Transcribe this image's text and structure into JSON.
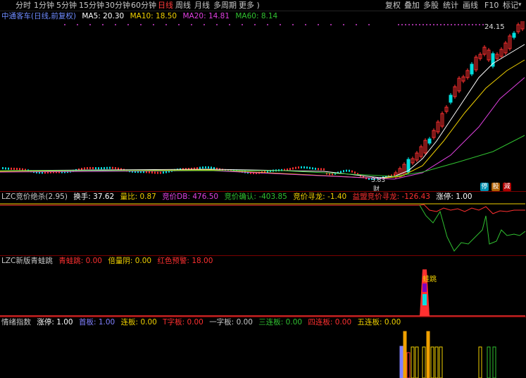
{
  "toolbar": {
    "periods": [
      "分时",
      "1分钟",
      "5分钟",
      "15分钟",
      "30分钟",
      "60分钟",
      "日线",
      "周线",
      "月线",
      "多周期",
      "更多 )"
    ],
    "active_period": "日线",
    "tools": [
      "复权",
      "叠加",
      "多股",
      "统计",
      "画线",
      "F10",
      "标记"
    ],
    "menu_icon": "chevron-down-icon"
  },
  "main_panel": {
    "stock_name": "中通客车",
    "mode": "(日线,前复权)",
    "ma": [
      {
        "label": "MA5: 20.30",
        "color": "#ffffff"
      },
      {
        "label": "MA10: 18.50",
        "color": "#f0d000"
      },
      {
        "label": "MA20: 14.81",
        "color": "#e040e0"
      },
      {
        "label": "MA60: 8.14",
        "color": "#30c030"
      }
    ],
    "high_label": "24.15",
    "low_label": "3.83",
    "cai_label": "财",
    "badges": [
      {
        "text": "停",
        "color": "#00a0c0"
      },
      {
        "text": "股",
        "color": "#c07000"
      },
      {
        "text": "減",
        "color": "#c00000"
      }
    ]
  },
  "panel2": {
    "items": [
      {
        "label": "LZC竞价绝杀(2.95)",
        "color": "#c8c8c8"
      },
      {
        "label": "换手: 37.62",
        "color": "#ffffff"
      },
      {
        "label": "量比: 0.87",
        "color": "#f0d000"
      },
      {
        "label": "竞价DB: 476.50",
        "color": "#e040e0"
      },
      {
        "label": "竞价确认: -403.85",
        "color": "#30c030"
      },
      {
        "label": "竞价寻龙: -1.40",
        "color": "#f0d000"
      },
      {
        "label": "益盟竞价寻龙: -126.43",
        "color": "#ff3030"
      },
      {
        "label": "涨停: 1.00",
        "color": "#ffffff"
      }
    ]
  },
  "panel3": {
    "items": [
      {
        "label": "LZC新版青蛙跳",
        "color": "#c8c8c8"
      },
      {
        "label": "青蛙跳: 0.00",
        "color": "#ff3030"
      },
      {
        "label": "倍量阴: 0.00",
        "color": "#f0d000"
      },
      {
        "label": "红色预警: 18.00",
        "color": "#ff3030"
      }
    ],
    "marker": "蛙跳"
  },
  "panel4": {
    "items": [
      {
        "label": "情绪指数",
        "color": "#c8c8c8"
      },
      {
        "label": "涨停: 1.00",
        "color": "#ffffff"
      },
      {
        "label": "首板: 1.00",
        "color": "#8080ff"
      },
      {
        "label": "连板: 0.00",
        "color": "#f0d000"
      },
      {
        "label": "T字板: 0.00",
        "color": "#ff3030"
      },
      {
        "label": "一字板: 0.00",
        "color": "#c8c8c8"
      },
      {
        "label": "三连板: 0.00",
        "color": "#30c030"
      },
      {
        "label": "四连板: 0.00",
        "color": "#ff3030"
      },
      {
        "label": "五连板: 0.00",
        "color": "#f0d000"
      }
    ]
  },
  "colors": {
    "up": "#ff3030",
    "down": "#00e0e0",
    "bg": "#000000"
  }
}
